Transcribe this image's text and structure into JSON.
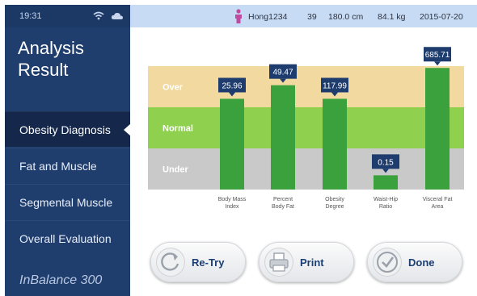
{
  "status_bar": {
    "time": "19:31",
    "icons": [
      "wifi-icon",
      "cloud-icon"
    ]
  },
  "sidebar": {
    "title_line1": "Analysis",
    "title_line2": "Result",
    "items": [
      {
        "label": "Obesity Diagnosis",
        "active": true
      },
      {
        "label": "Fat and Muscle",
        "active": false
      },
      {
        "label": "Segmental Muscle",
        "active": false
      },
      {
        "label": "Overall Evaluation",
        "active": false
      }
    ],
    "brand": "InBalance 300"
  },
  "header": {
    "user": "Hong1234",
    "age": "39",
    "height": "180.0 cm",
    "weight": "84.1 kg",
    "date": "2015-07-20"
  },
  "chart_data": {
    "type": "bar",
    "bands": [
      {
        "label": "Over",
        "color": "#f2d9a0"
      },
      {
        "label": "Normal",
        "color": "#8fd14f"
      },
      {
        "label": "Under",
        "color": "#c9c9c9"
      }
    ],
    "categories": [
      [
        "Body Mass",
        "Index"
      ],
      [
        "Percent",
        "Body Fat"
      ],
      [
        "Obesity",
        "Degree"
      ],
      [
        "Waist-Hip",
        "Ratio"
      ],
      [
        "Visceral Fat",
        "Area"
      ]
    ],
    "value_labels": [
      "25.96",
      "49.47",
      "117.99",
      "0.15",
      "685.71"
    ],
    "levels": [
      0.67,
      0.78,
      0.67,
      0.05,
      0.92
    ],
    "bar_color": "#3aa13c",
    "label_color": "#1e3d6e"
  },
  "buttons": [
    {
      "label": "Re-Try",
      "icon": "retry-icon"
    },
    {
      "label": "Print",
      "icon": "printer-icon"
    },
    {
      "label": "Done",
      "icon": "checkmark-icon"
    }
  ]
}
